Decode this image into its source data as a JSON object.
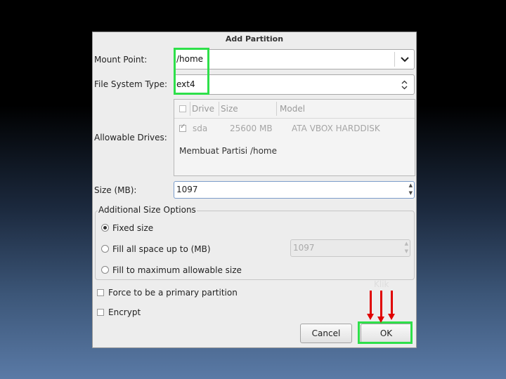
{
  "dialog": {
    "title": "Add Partition",
    "mount_point": {
      "label": "Mount Point:",
      "value": "/home"
    },
    "fs_type": {
      "label": "File System Type:",
      "value": "ext4"
    },
    "drives": {
      "label": "Allowable Drives:",
      "headers": [
        "Drive",
        "Size",
        "Model"
      ],
      "rows": [
        {
          "drive": "sda",
          "size": "25600 MB",
          "model": "ATA VBOX HARDDISK",
          "checked": true
        }
      ],
      "note": "Membuat Partisi /home"
    },
    "size": {
      "label": "Size (MB):",
      "value": "1097"
    },
    "size_options": {
      "title": "Additional Size Options",
      "fixed": "Fixed size",
      "fill_up_to": "Fill all space up to (MB)",
      "fill_up_to_value": "1097",
      "fill_max": "Fill to maximum allowable size",
      "selected": "fixed"
    },
    "primary_checkbox": "Force to be a primary partition",
    "encrypt_checkbox": "Encrypt",
    "buttons": {
      "cancel": "Cancel",
      "ok": "OK"
    }
  },
  "annotation": {
    "klik_label": "Klik",
    "highlight_color": "#2ee04a",
    "arrow_color": "#e00000"
  }
}
